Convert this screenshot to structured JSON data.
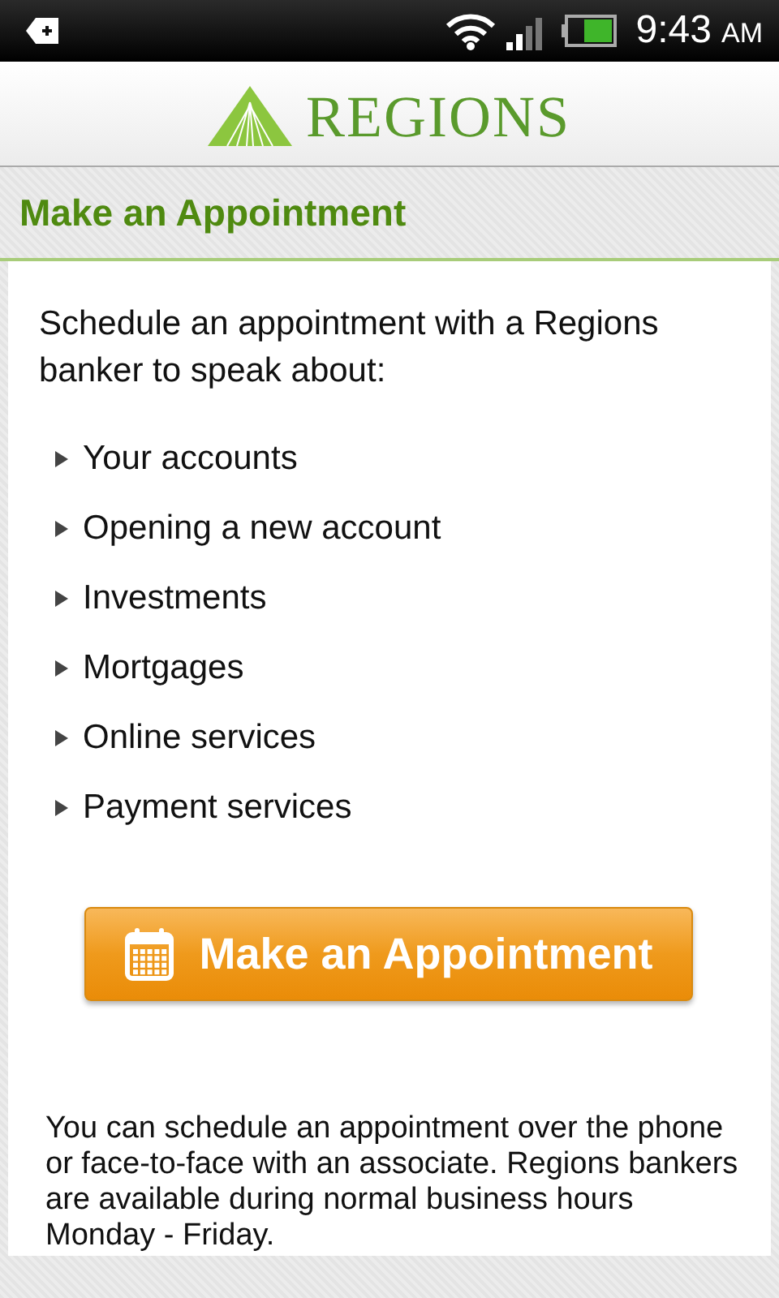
{
  "status_bar": {
    "time": "9:43",
    "ampm": "AM"
  },
  "header": {
    "logo_text": "REGIONS"
  },
  "section": {
    "title": "Make an Appointment"
  },
  "intro": "Schedule an appointment with a Regions banker to speak about:",
  "topics": [
    "Your accounts",
    "Opening a new account",
    "Investments",
    "Mortgages",
    "Online services",
    "Payment services"
  ],
  "button": {
    "label": "Make an Appointment"
  },
  "note": "You can schedule an appointment over the phone or face-to-face with an associate. Regions bankers are available during normal business hours Monday - Friday."
}
